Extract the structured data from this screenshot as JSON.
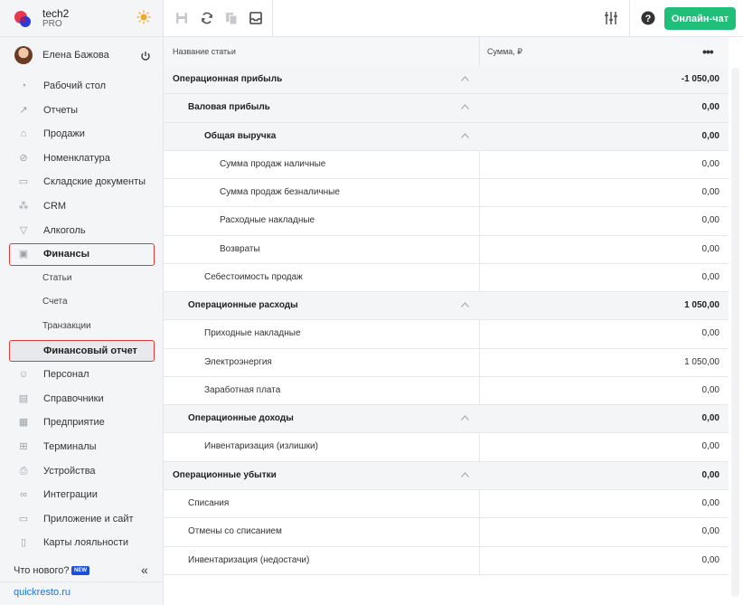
{
  "brand": {
    "name": "tech2",
    "plan": "PRO"
  },
  "user": {
    "name": "Елена Бажова"
  },
  "nav": [
    {
      "label": "Рабочий стол",
      "icon": "dashboard-icon"
    },
    {
      "label": "Отчеты",
      "icon": "chart-icon"
    },
    {
      "label": "Продажи",
      "icon": "basket-icon"
    },
    {
      "label": "Номенклатура",
      "icon": "tag-icon"
    },
    {
      "label": "Складские документы",
      "icon": "warehouse-icon"
    },
    {
      "label": "CRM",
      "icon": "people-icon"
    },
    {
      "label": "Алкоголь",
      "icon": "glass-icon"
    },
    {
      "label": "Финансы",
      "icon": "wallet-icon"
    },
    {
      "label": "Статьи"
    },
    {
      "label": "Счета"
    },
    {
      "label": "Транзакции"
    },
    {
      "label": "Финансовый отчет"
    },
    {
      "label": "Персонал",
      "icon": "staff-icon"
    },
    {
      "label": "Справочники",
      "icon": "book-icon"
    },
    {
      "label": "Предприятие",
      "icon": "building-icon"
    },
    {
      "label": "Терминалы",
      "icon": "terminal-icon"
    },
    {
      "label": "Устройства",
      "icon": "printer-icon"
    },
    {
      "label": "Интеграции",
      "icon": "link-icon"
    },
    {
      "label": "Приложение и сайт",
      "icon": "monitor-icon"
    },
    {
      "label": "Карты лояльности",
      "icon": "card-icon"
    }
  ],
  "whatsnew": {
    "label": "Что нового?",
    "badge": "NEW"
  },
  "footer": {
    "link": "quickresto.ru"
  },
  "toolbar": {
    "chat_label": "Онлайн-чат"
  },
  "table": {
    "col_name": "Название статьи",
    "col_sum": "Сумма, ₽",
    "rows": [
      {
        "name": "Операционная прибыль",
        "value": "-1 050,00"
      },
      {
        "name": "Валовая прибыль",
        "value": "0,00"
      },
      {
        "name": "Общая выручка",
        "value": "0,00"
      },
      {
        "name": "Сумма продаж наличные",
        "value": "0,00"
      },
      {
        "name": "Сумма продаж безналичные",
        "value": "0,00"
      },
      {
        "name": "Расходные накладные",
        "value": "0,00"
      },
      {
        "name": "Возвраты",
        "value": "0,00"
      },
      {
        "name": "Себестоимость продаж",
        "value": "0,00"
      },
      {
        "name": "Операционные расходы",
        "value": "1 050,00"
      },
      {
        "name": "Приходные накладные",
        "value": "0,00"
      },
      {
        "name": "Электроэнергия",
        "value": "1 050,00"
      },
      {
        "name": "Заработная плата",
        "value": "0,00"
      },
      {
        "name": "Операционные доходы",
        "value": "0,00"
      },
      {
        "name": "Инвентаризация (излишки)",
        "value": "0,00"
      },
      {
        "name": "Операционные убытки",
        "value": "0,00"
      },
      {
        "name": "Списания",
        "value": "0,00"
      },
      {
        "name": "Отмены со списанием",
        "value": "0,00"
      },
      {
        "name": "Инвентаризация (недостачи)",
        "value": "0,00"
      }
    ]
  }
}
